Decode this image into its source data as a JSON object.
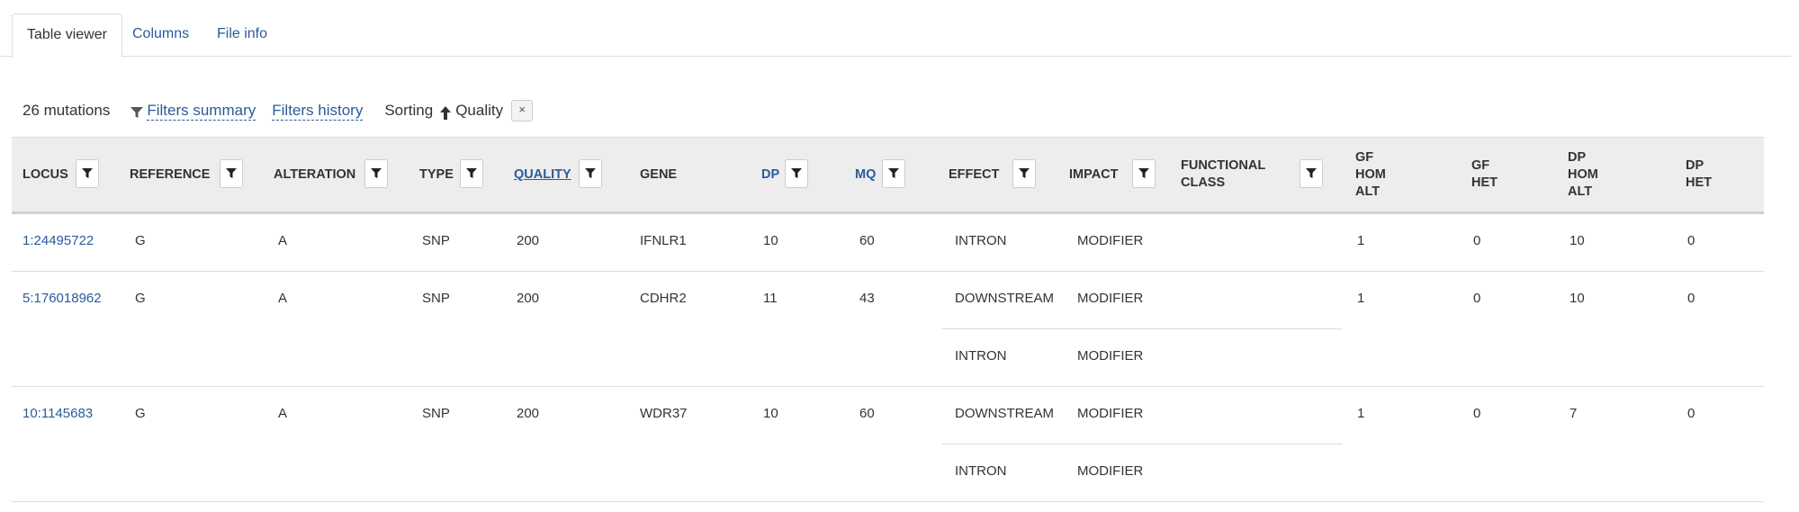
{
  "tabs": [
    {
      "label": "Table viewer",
      "active": true
    },
    {
      "label": "Columns",
      "active": false
    },
    {
      "label": "File info",
      "active": false
    }
  ],
  "summary": {
    "count": "26 mutations",
    "filters_summary": "Filters summary",
    "filters_history": "Filters history",
    "sorting_label": "Sorting",
    "sort_column": "Quality",
    "sort_direction": "ascending",
    "clear_sort": "×"
  },
  "columns": [
    {
      "key": "locus",
      "label": "LOCUS",
      "filter": true
    },
    {
      "key": "reference",
      "label": "REFERENCE",
      "filter": true
    },
    {
      "key": "alteration",
      "label": "ALTERATION",
      "filter": true
    },
    {
      "key": "type",
      "label": "TYPE",
      "filter": true
    },
    {
      "key": "quality",
      "label": "QUALITY",
      "filter": true,
      "sorted": true
    },
    {
      "key": "gene",
      "label": "GENE",
      "filter": false
    },
    {
      "key": "dp",
      "label": "DP",
      "filter": true,
      "sortable": true
    },
    {
      "key": "mq",
      "label": "MQ",
      "filter": true,
      "sortable": true
    },
    {
      "key": "effect",
      "label": "EFFECT",
      "filter": true
    },
    {
      "key": "impact",
      "label": "IMPACT",
      "filter": true
    },
    {
      "key": "functional_class",
      "label": "FUNCTIONAL CLASS",
      "filter": true
    },
    {
      "key": "gf_hom_alt",
      "label": "GF HOM ALT",
      "filter": false
    },
    {
      "key": "gf_het",
      "label": "GF HET",
      "filter": false
    },
    {
      "key": "dp_hom_alt",
      "label": "DP HOM ALT",
      "filter": false
    },
    {
      "key": "dp_het",
      "label": "DP HET",
      "filter": false
    }
  ],
  "rows": [
    {
      "locus": "1:24495722",
      "reference": "G",
      "alteration": "A",
      "type": "SNP",
      "quality": "200",
      "gene": "IFNLR1",
      "dp": "10",
      "mq": "60",
      "effects": [
        {
          "effect": "INTRON",
          "impact": "MODIFIER",
          "functional_class": ""
        }
      ],
      "gf_hom_alt": "1",
      "gf_het": "0",
      "dp_hom_alt": "10",
      "dp_het": "0"
    },
    {
      "locus": "5:176018962",
      "reference": "G",
      "alteration": "A",
      "type": "SNP",
      "quality": "200",
      "gene": "CDHR2",
      "dp": "11",
      "mq": "43",
      "effects": [
        {
          "effect": "DOWNSTREAM",
          "impact": "MODIFIER",
          "functional_class": ""
        },
        {
          "effect": "INTRON",
          "impact": "MODIFIER",
          "functional_class": ""
        }
      ],
      "gf_hom_alt": "1",
      "gf_het": "0",
      "dp_hom_alt": "10",
      "dp_het": "0"
    },
    {
      "locus": "10:1145683",
      "reference": "G",
      "alteration": "A",
      "type": "SNP",
      "quality": "200",
      "gene": "WDR37",
      "dp": "10",
      "mq": "60",
      "effects": [
        {
          "effect": "DOWNSTREAM",
          "impact": "MODIFIER",
          "functional_class": ""
        },
        {
          "effect": "INTRON",
          "impact": "MODIFIER",
          "functional_class": ""
        }
      ],
      "gf_hom_alt": "1",
      "gf_het": "0",
      "dp_hom_alt": "7",
      "dp_het": "0"
    }
  ]
}
